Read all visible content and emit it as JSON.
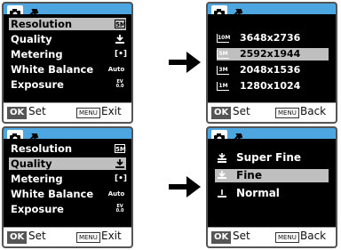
{
  "colors": {
    "tabbar": "#4da6e0",
    "selection": "#bfbfbf",
    "screen_bg": "#000000"
  },
  "menu": {
    "items": [
      {
        "label": "Resolution",
        "icon": "5M"
      },
      {
        "label": "Quality",
        "icon": "quality-icon"
      },
      {
        "label": "Metering",
        "icon": "[•]"
      },
      {
        "label": "White Balance",
        "icon": "Auto"
      },
      {
        "label": "Exposure",
        "icon": "EV 0.0"
      }
    ]
  },
  "resolution": {
    "options": [
      {
        "badge": "10M",
        "value": "3648x2736"
      },
      {
        "badge": "5M",
        "value": "2592x1944"
      },
      {
        "badge": "3M",
        "value": "2048x1536"
      },
      {
        "badge": "1M",
        "value": "1280x1024"
      }
    ]
  },
  "quality": {
    "options": [
      {
        "value": "Super Fine"
      },
      {
        "value": "Fine"
      },
      {
        "value": "Normal"
      }
    ]
  },
  "footer": {
    "ok": "OK",
    "set": "Set",
    "menu": "MENU",
    "exit": "Exit",
    "back": "Back"
  }
}
